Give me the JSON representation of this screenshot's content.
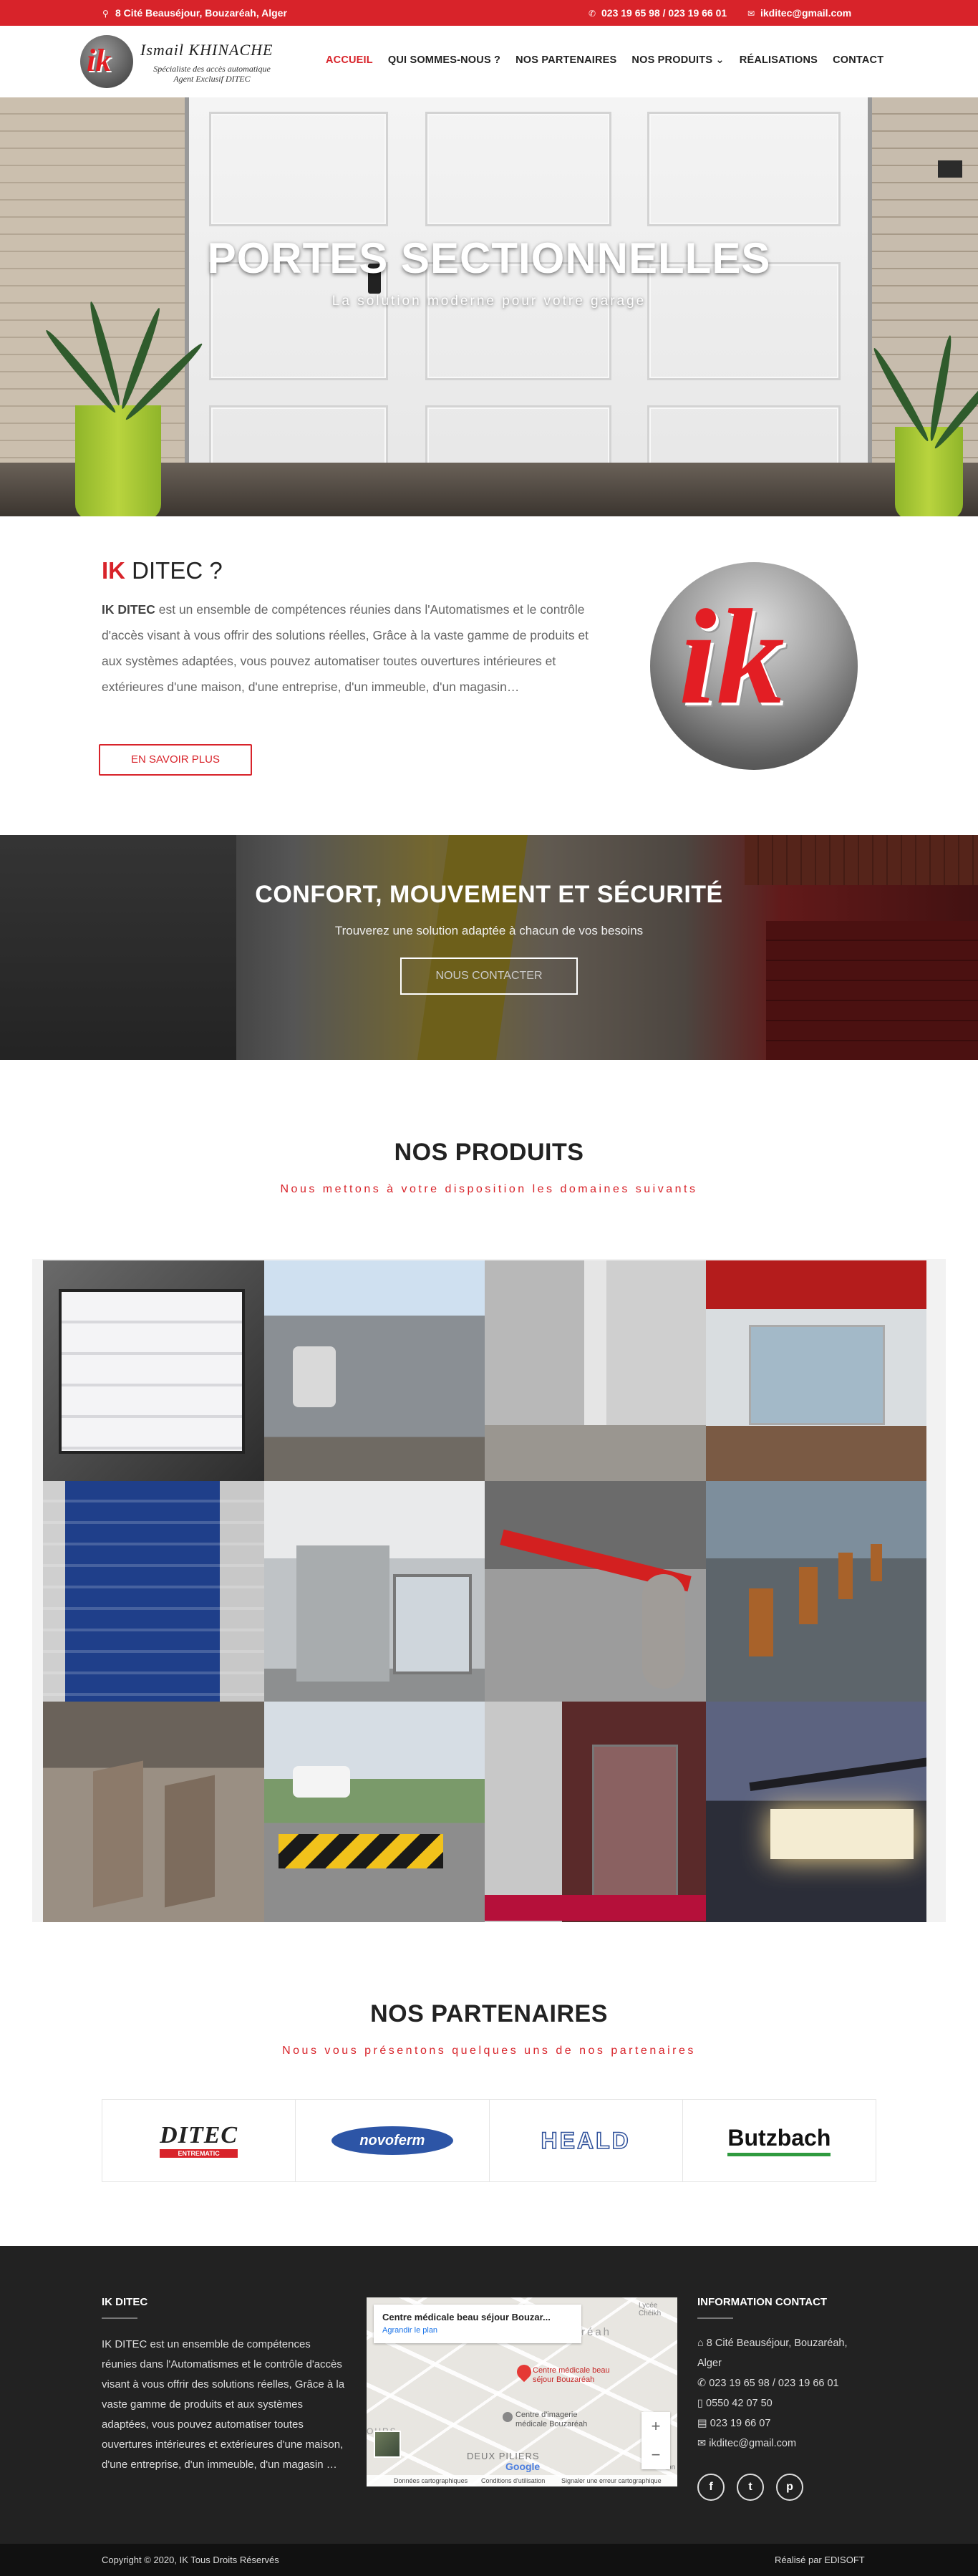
{
  "topbar": {
    "address": "8 Cité Beauséjour, Bouzaréah, Alger",
    "phones": "023 19 65 98 / 023 19 66 01",
    "email": "ikditec@gmail.com"
  },
  "logo": {
    "mark": "ik",
    "name": "Ismail KHINACHE",
    "tagline_1": "Spécialiste des accès automatique",
    "tagline_2": "Agent Exclusif DITEC"
  },
  "menu": [
    {
      "label": "ACCUEIL",
      "active": true
    },
    {
      "label": "QUI SOMMES-NOUS ?"
    },
    {
      "label": "NOS PARTENAIRES"
    },
    {
      "label": "NOS PRODUITS ⌄"
    },
    {
      "label": "RÉALISATIONS"
    },
    {
      "label": "CONTACT"
    }
  ],
  "hero": {
    "title": "PORTES SECTIONNELLES",
    "subtitle": "La solution moderne pour votre garage"
  },
  "about": {
    "title_accent": "IK",
    "title_rest": " DITEC ?",
    "lead_bold": "IK DITEC",
    "text": " est un ensemble de compétences réunies dans l'Automatismes et le contrôle d'accès visant à vous offrir des solutions réelles, Grâce à la vaste gamme de produits et aux systèmes adaptées, vous pouvez automatiser toutes ouvertures intérieures et extérieures d'une maison, d'une entreprise, d'un immeuble, d'un magasin…",
    "button": "EN SAVOIR PLUS",
    "logo_mark": "ik"
  },
  "cta": {
    "title": "CONFORT, MOUVEMENT ET SÉCURITÉ",
    "text": "Trouverez une solution adaptée à chacun de vos besoins",
    "button": "NOUS CONTACTER"
  },
  "products": {
    "title": "NOS PRODUITS",
    "subtitle": "Nous mettons à votre disposition les domaines suivants"
  },
  "partners": {
    "title": "NOS PARTENAIRES",
    "subtitle": "Nous vous présentons quelques uns de nos partenaires",
    "logos": [
      "DITEC",
      "ENTREMATIC",
      "novoferm",
      "HEALD",
      "Butzbach"
    ]
  },
  "footer": {
    "about_title": "IK DITEC",
    "about_text": "IK DITEC est un ensemble de compétences réunies dans l'Automatismes et le contrôle d'accès visant à vous offrir des solutions réelles, Grâce à la vaste gamme de produits et aux systèmes adaptées, vous pouvez automatiser toutes ouvertures intérieures et extérieures d'une maison, d'une entreprise, d'un immeuble, d'un magasin …",
    "map": {
      "place_title": "Centre médicale beau séjour Bouzar...",
      "enlarge": "Agrandir le plan",
      "marker_label": "Centre médicale beau séjour Bouzaréah",
      "label_2": "Centre d'imagerie médicale Bouzaréah",
      "label_3": "DEUX PILIERS",
      "label_4": "Lycée Chéikh",
      "label_5": "réah",
      "label_6": "OURS",
      "label_7": "La Fon",
      "zoom_in": "+",
      "zoom_out": "−",
      "google": "Google",
      "legal_1": "Données cartographiques",
      "legal_2": "Conditions d'utilisation",
      "legal_3": "Signaler une erreur cartographique"
    },
    "contact_title": "INFORMATION CONTACT",
    "contact_address_1": "8 Cité Beauséjour, Bouzaréah,",
    "contact_address_2": "Alger",
    "contact_phone": "023 19 65 98 / 023 19 66 01",
    "contact_mobile": "0550 42 07 50",
    "contact_fax": "023 19 66 07",
    "contact_email": "ikditec@gmail.com",
    "social": [
      "f",
      "t",
      "p"
    ]
  },
  "bottom": {
    "copyright": "Copyright © 2020, IK Tous Droits Réservés",
    "credit": "Réalisé par EDISOFT"
  },
  "colors": {
    "accent": "#d8232a",
    "footer_bg": "#222222",
    "bottom_bg": "#111111"
  }
}
